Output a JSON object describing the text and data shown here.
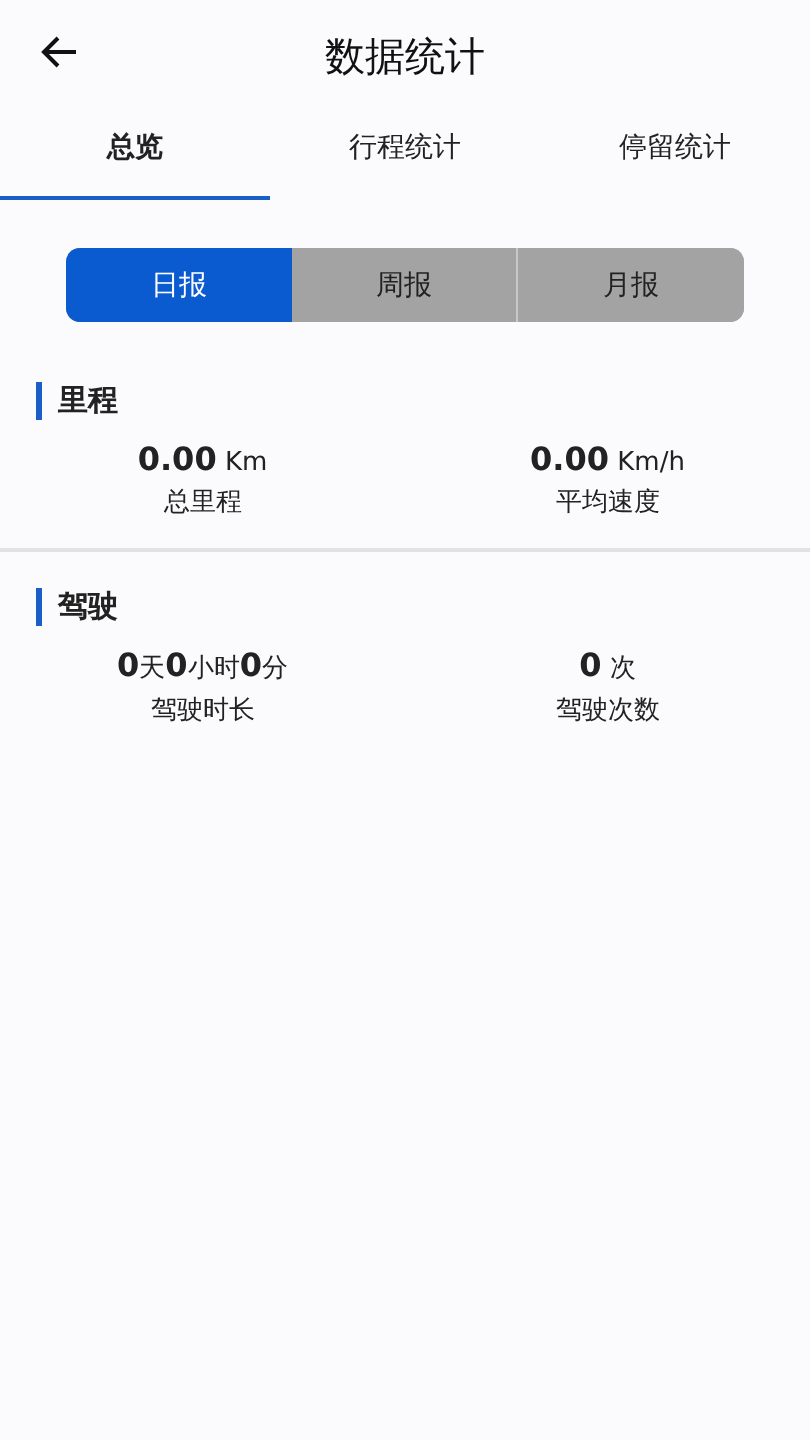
{
  "header": {
    "title": "数据统计"
  },
  "tabs": [
    {
      "label": "总览",
      "selected": true
    },
    {
      "label": "行程统计",
      "selected": false
    },
    {
      "label": "停留统计",
      "selected": false
    }
  ],
  "periods": [
    {
      "label": "日报",
      "selected": true
    },
    {
      "label": "周报",
      "selected": false
    },
    {
      "label": "月报",
      "selected": false
    }
  ],
  "sections": [
    {
      "title": "里程",
      "stats": [
        {
          "value": "**0.00** Km",
          "label": "总里程"
        },
        {
          "value": "**0.00** Km/h",
          "label": "平均速度"
        }
      ]
    },
    {
      "title": "驾驶",
      "stats": [
        {
          "value": "**0**天**0**小时**0**分",
          "label": "驾驶时长"
        },
        {
          "value": "**0** 次",
          "label": "驾驶次数"
        }
      ]
    }
  ]
}
